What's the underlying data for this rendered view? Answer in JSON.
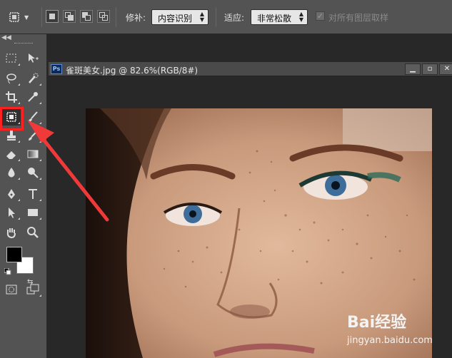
{
  "options_bar": {
    "feather_label": "修补:",
    "feather_value": "内容识别",
    "adapt_label": "适应:",
    "adapt_value": "非常松散",
    "sample_all_label": "对所有图层取样",
    "sample_all_checked": true
  },
  "tools": [
    {
      "name": "marquee-tool-icon"
    },
    {
      "name": "move-tool-icon"
    },
    {
      "name": "lasso-tool-icon"
    },
    {
      "name": "quick-selection-tool-icon"
    },
    {
      "name": "crop-tool-icon"
    },
    {
      "name": "eyedropper-tool-icon"
    },
    {
      "name": "patch-tool-icon"
    },
    {
      "name": "brush-tool-icon"
    },
    {
      "name": "clone-stamp-tool-icon"
    },
    {
      "name": "history-brush-tool-icon"
    },
    {
      "name": "eraser-tool-icon"
    },
    {
      "name": "gradient-tool-icon"
    },
    {
      "name": "blur-tool-icon"
    },
    {
      "name": "dodge-tool-icon"
    },
    {
      "name": "pen-tool-icon"
    },
    {
      "name": "type-tool-icon"
    },
    {
      "name": "path-selection-tool-icon"
    },
    {
      "name": "rectangle-tool-icon"
    },
    {
      "name": "hand-tool-icon"
    },
    {
      "name": "zoom-tool-icon"
    }
  ],
  "colors": {
    "foreground": "#000000",
    "background": "#ffffff",
    "highlight": "#ff2020",
    "arrow": "#f03a3a"
  },
  "document": {
    "badge": "Ps",
    "title": "雀斑美女.jpg @ 82.6%(RGB/8#)"
  },
  "watermark": {
    "brand": "Bai经验",
    "url": "jingyan.baidu.com"
  }
}
